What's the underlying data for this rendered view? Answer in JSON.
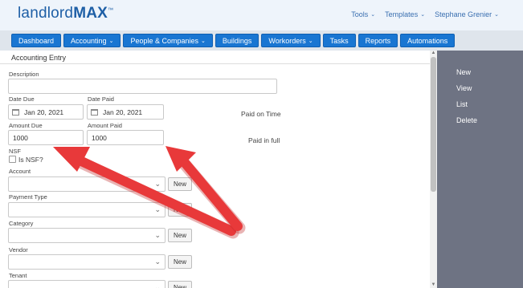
{
  "header": {
    "logo_light": "landlord",
    "logo_bold": "MAX",
    "logo_tm": "™",
    "menu": [
      {
        "label": "Tools"
      },
      {
        "label": "Templates"
      },
      {
        "label": "Stephane Grenier"
      }
    ]
  },
  "nav": {
    "items": [
      {
        "label": "Dashboard",
        "dropdown": false
      },
      {
        "label": "Accounting",
        "dropdown": true
      },
      {
        "label": "People & Companies",
        "dropdown": true
      },
      {
        "label": "Buildings",
        "dropdown": false
      },
      {
        "label": "Workorders",
        "dropdown": true
      },
      {
        "label": "Tasks",
        "dropdown": false
      },
      {
        "label": "Reports",
        "dropdown": false
      },
      {
        "label": "Automations",
        "dropdown": false
      }
    ]
  },
  "form": {
    "title": "Accounting Entry",
    "description_label": "Description",
    "description_value": "",
    "date_due_label": "Date Due",
    "date_due_value": "Jan 20, 2021",
    "date_paid_label": "Date Paid",
    "date_paid_value": "Jan 20, 2021",
    "paid_status": "Paid on Time",
    "amount_due_label": "Amount Due",
    "amount_due_value": "1000",
    "amount_paid_label": "Amount Paid",
    "amount_paid_value": "1000",
    "paid_full_status": "Paid in full",
    "nsf_label": "NSF",
    "nsf_checkbox_label": "Is NSF?",
    "account_label": "Account",
    "payment_type_label": "Payment Type",
    "category_label": "Category",
    "vendor_label": "Vendor",
    "tenant_label": "Tenant",
    "new_label": "New"
  },
  "sidebar": {
    "items": [
      {
        "label": "New"
      },
      {
        "label": "View"
      },
      {
        "label": "List"
      },
      {
        "label": "Delete"
      }
    ]
  },
  "colors": {
    "brand": "#1e5fa6",
    "nav_button": "#1976d2",
    "side_panel": "#6e7383",
    "arrow": "#e8393a"
  }
}
